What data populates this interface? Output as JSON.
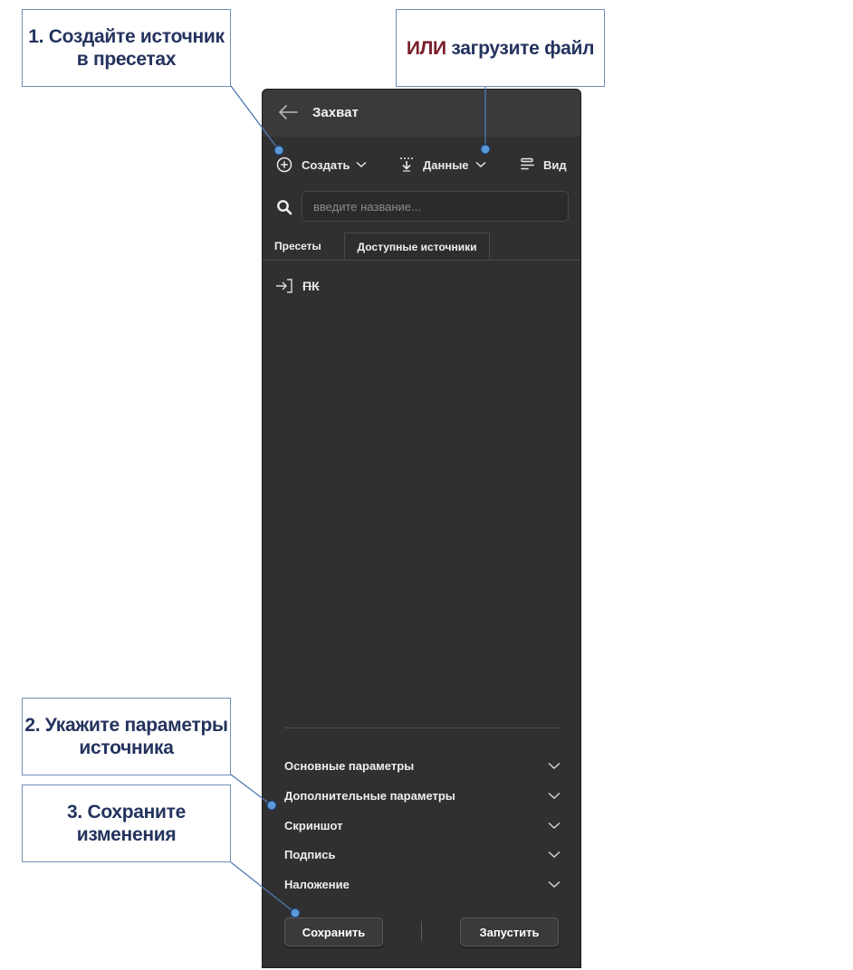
{
  "callouts": {
    "step1": {
      "line1": "1. Создайте источник",
      "line2": "в пресетах"
    },
    "alt": {
      "prefix": "ИЛИ",
      "text": "загрузите файл"
    },
    "step2": {
      "line1": "2. Укажите параметры",
      "line2": "источника"
    },
    "step3": {
      "line1": "3. Сохраните",
      "line2": "изменения"
    }
  },
  "header": {
    "title": "Захват",
    "back_icon": "arrow-left-icon"
  },
  "toolbar": {
    "create_label": "Создать",
    "data_label": "Данные",
    "view_label": "Вид"
  },
  "search": {
    "placeholder": "введите название..."
  },
  "tabs": [
    {
      "label": "Пресеты",
      "active": true
    },
    {
      "label": "Доступные источники",
      "active": false
    }
  ],
  "presets": [
    {
      "name": "ПК",
      "icon": "sign-in-icon"
    }
  ],
  "sections": [
    {
      "label": "Основные параметры"
    },
    {
      "label": "Дополнительные параметры"
    },
    {
      "label": "Скриншот"
    },
    {
      "label": "Подпись"
    },
    {
      "label": "Наложение"
    }
  ],
  "buttons": {
    "save": "Сохранить",
    "run": "Запустить"
  },
  "colors": {
    "panel_bg": "#303030",
    "header_bg": "#3a3a3c",
    "callout_text": "#24335e",
    "callout_accent": "#7a1e2b",
    "leader_line": "#4f78b0",
    "marker_fill": "#5b9ad6"
  }
}
